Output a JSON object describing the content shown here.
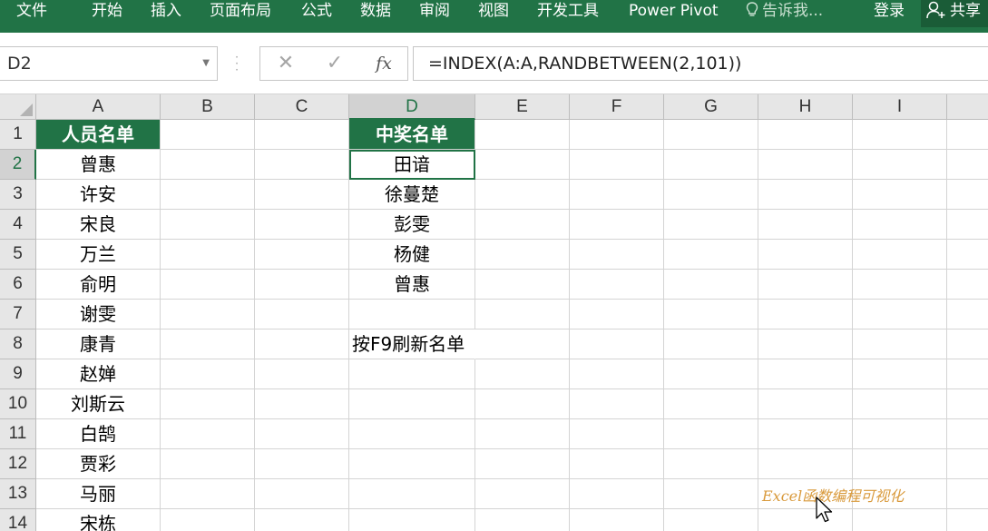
{
  "ribbon": {
    "tabs": [
      "文件",
      "开始",
      "插入",
      "页面布局",
      "公式",
      "数据",
      "审阅",
      "视图",
      "开发工具",
      "Power Pivot"
    ],
    "tell_me": "告诉我...",
    "login": "登录",
    "share": "共享"
  },
  "formula_bar": {
    "name_box": "D2",
    "cancel_symbol": "✕",
    "enter_symbol": "✓",
    "fx_symbol": "fx",
    "formula": "=INDEX(A:A,RANDBETWEEN(2,101))"
  },
  "sheet": {
    "columns": [
      "A",
      "B",
      "C",
      "D",
      "E",
      "F",
      "G",
      "H",
      "I"
    ],
    "rows": [
      "1",
      "2",
      "3",
      "4",
      "5",
      "6",
      "7",
      "8",
      "9",
      "10",
      "11",
      "12",
      "13",
      "14"
    ],
    "selected_cell": "D2",
    "column_a": {
      "header": "人员名单",
      "names": [
        "曾惠",
        "许安",
        "宋良",
        "万兰",
        "俞明",
        "谢雯",
        "康青",
        "赵婵",
        "刘斯云",
        "白鹄",
        "贾彩",
        "马丽",
        "宋栋"
      ]
    },
    "column_d": {
      "header": "中奖名单",
      "winners": [
        "田谙",
        "徐蔓楚",
        "彭雯",
        "杨健",
        "曾惠"
      ],
      "note": "按F9刷新名单"
    }
  },
  "watermark": "Excel函数编程可视化",
  "colors": {
    "ribbon_green": "#217346",
    "header_fill": "#217346",
    "header_text": "#ffffff",
    "watermark": "#d99a3c"
  },
  "icons": [
    "lightbulb-icon",
    "user-icon",
    "dropdown-arrow-icon",
    "cancel-icon",
    "enter-icon",
    "fx-icon",
    "select-all-triangle-icon",
    "mouse-cursor-icon"
  ]
}
